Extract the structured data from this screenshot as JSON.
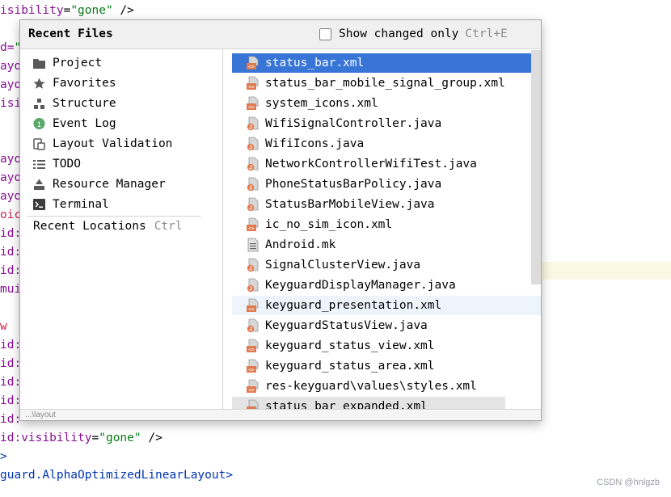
{
  "editor": {
    "lines": [
      {
        "tokens": [
          {
            "c": "tok-attr",
            "t": "isibility"
          },
          {
            "c": "tok-pl",
            "t": "="
          },
          {
            "c": "tok-str",
            "t": "\"gone\""
          },
          {
            "c": "tok-pl",
            "t": " />"
          }
        ]
      },
      {
        "tokens": [
          {
            "c": "tok-attr",
            "t": "d="
          },
          {
            "c": "tok-str",
            "t": "\""
          }
        ]
      },
      {
        "tokens": [
          {
            "c": "tok-attr",
            "t": "ayo"
          }
        ]
      },
      {
        "tokens": [
          {
            "c": "tok-attr",
            "t": "ayo"
          }
        ]
      },
      {
        "tokens": [
          {
            "c": "tok-attr",
            "t": "isi"
          }
        ]
      },
      {
        "tokens": [
          {
            "c": "tok-attr",
            "t": "ayo"
          }
        ]
      },
      {
        "tokens": [
          {
            "c": "tok-attr",
            "t": "ayo"
          }
        ]
      },
      {
        "tokens": [
          {
            "c": "tok-attr",
            "t": "ayo"
          }
        ]
      },
      {
        "tokens": [
          {
            "c": "tok-red",
            "t": "oic"
          }
        ]
      },
      {
        "tokens": [
          {
            "c": "tok-attr",
            "t": "id:"
          }
        ]
      },
      {
        "tokens": [
          {
            "c": "tok-attr",
            "t": "id:"
          }
        ]
      },
      {
        "tokens": [
          {
            "c": "tok-attr",
            "t": "id:"
          }
        ]
      },
      {
        "tokens": [
          {
            "c": "tok-attr",
            "t": "mui"
          }
        ]
      },
      {
        "tokens": [
          {
            "c": "tok-red",
            "t": "w"
          }
        ]
      },
      {
        "tokens": [
          {
            "c": "tok-attr",
            "t": "id:"
          }
        ]
      },
      {
        "tokens": [
          {
            "c": "tok-attr",
            "t": "id:"
          }
        ]
      },
      {
        "tokens": [
          {
            "c": "tok-attr",
            "t": "id:"
          }
        ]
      },
      {
        "tokens": [
          {
            "c": "tok-attr",
            "t": "id:"
          }
        ]
      },
      {
        "tokens": [
          {
            "c": "tok-attr",
            "t": "id:"
          }
        ]
      },
      {
        "tokens": [
          {
            "c": "tok-attr",
            "t": "id:visibility"
          },
          {
            "c": "tok-pl",
            "t": "="
          },
          {
            "c": "tok-str",
            "t": "\"gone\""
          },
          {
            "c": "tok-pl",
            "t": " />"
          }
        ]
      },
      {
        "tokens": [
          {
            "c": "tok-tag",
            "t": ">"
          }
        ]
      },
      {
        "tokens": [
          {
            "c": "tok-tag",
            "t": "guard.AlphaOptimizedLinearLayout>"
          }
        ]
      }
    ]
  },
  "watermark": "CSDN @hnlgzb",
  "popup": {
    "title": "Recent Files",
    "show_changed_label": "Show changed only",
    "show_changed_shortcut": "Ctrl+E",
    "tool_windows": [
      {
        "label": "Project",
        "icon": "folder-icon"
      },
      {
        "label": "Favorites",
        "icon": "star-icon"
      },
      {
        "label": "Structure",
        "icon": "structure-icon"
      },
      {
        "label": "Event Log",
        "icon": "event-log-badge-icon",
        "badge": "1"
      },
      {
        "label": "Layout Validation",
        "icon": "layout-validation-icon"
      },
      {
        "label": "TODO",
        "icon": "todo-list-icon"
      },
      {
        "label": "Resource Manager",
        "icon": "resource-manager-icon"
      },
      {
        "label": "Terminal",
        "icon": "terminal-icon"
      }
    ],
    "recent_locations": {
      "label": "Recent Locations",
      "shortcut": "Ctrl"
    },
    "files": [
      {
        "name": "status_bar.xml",
        "type": "xml"
      },
      {
        "name": "status_bar_mobile_signal_group.xml",
        "type": "xml"
      },
      {
        "name": "system_icons.xml",
        "type": "xml"
      },
      {
        "name": "WifiSignalController.java",
        "type": "java"
      },
      {
        "name": "WifiIcons.java",
        "type": "java"
      },
      {
        "name": "NetworkControllerWifiTest.java",
        "type": "java"
      },
      {
        "name": "PhoneStatusBarPolicy.java",
        "type": "java"
      },
      {
        "name": "StatusBarMobileView.java",
        "type": "java"
      },
      {
        "name": "ic_no_sim_icon.xml",
        "type": "xml"
      },
      {
        "name": "Android.mk",
        "type": "text"
      },
      {
        "name": "SignalClusterView.java",
        "type": "java"
      },
      {
        "name": "KeyguardDisplayManager.java",
        "type": "java"
      },
      {
        "name": "keyguard_presentation.xml",
        "type": "xml"
      },
      {
        "name": "KeyguardStatusView.java",
        "type": "java"
      },
      {
        "name": "keyguard_status_view.xml",
        "type": "xml"
      },
      {
        "name": "keyguard_status_area.xml",
        "type": "xml"
      },
      {
        "name": "res-keyguard\\values\\styles.xml",
        "type": "xml"
      },
      {
        "name": "status_bar_expanded.xml",
        "type": "xml"
      }
    ],
    "selected_file_index": 0,
    "footer_path": "...\\layout",
    "colors": {
      "selection": "#3875d6",
      "hover": "#edf4fc",
      "xml_icon": "#e07a4f",
      "java_icon": "#e07a4f",
      "badge": "#59a869"
    }
  }
}
